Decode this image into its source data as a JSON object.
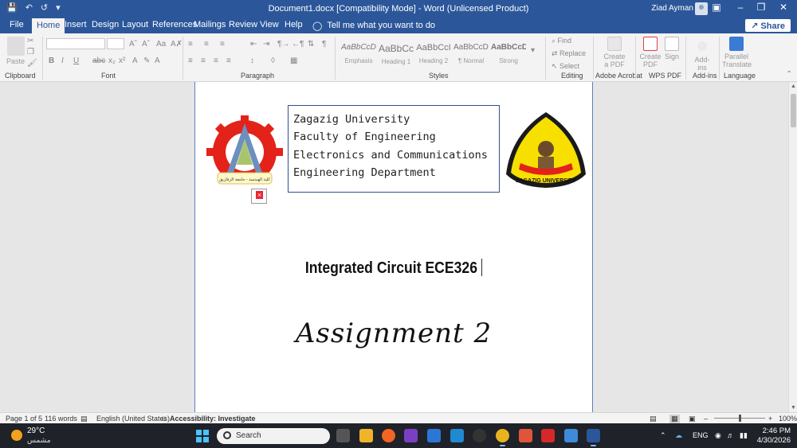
{
  "titlebar": {
    "title": "Document1.docx [Compatibility Mode]  -  Word (Unlicensed Product)",
    "user": "Ziad Ayman",
    "qat": [
      "save-icon",
      "undo-icon",
      "redo-icon",
      "customize-icon"
    ]
  },
  "tabs": [
    "File",
    "Home",
    "Insert",
    "Design",
    "Layout",
    "References",
    "Mailings",
    "Review",
    "View",
    "Help"
  ],
  "active_tab": "Home",
  "tellme": "Tell me what you want to do",
  "share": "Share",
  "ribbon": {
    "clipboard": {
      "label": "Clipboard",
      "paste": "Paste"
    },
    "font": {
      "label": "Font"
    },
    "paragraph": {
      "label": "Paragraph"
    },
    "styles": {
      "label": "Styles",
      "items": [
        {
          "sample": "AaBbCcDd",
          "name": "Emphasis"
        },
        {
          "sample": "AaBbCc",
          "name": "Heading 1"
        },
        {
          "sample": "AaBbCcI",
          "name": "Heading 2"
        },
        {
          "sample": "AaBbCcDdE",
          "name": "¶ Normal"
        },
        {
          "sample": "AaBbCcDc",
          "name": "Strong"
        }
      ]
    },
    "editing": {
      "label": "Editing",
      "find": "Find",
      "replace": "Replace",
      "select": "Select"
    },
    "acrobat": {
      "label": "Adobe Acrobat",
      "create": "Create\na PDF"
    },
    "wps": {
      "label": "WPS PDF",
      "create": "Create\nPDF",
      "sign": "Sign"
    },
    "addins": {
      "label": "Add-ins",
      "btn": "Add-ins"
    },
    "language": {
      "label": "Language",
      "btn": "Parallel\nTranslate"
    }
  },
  "document": {
    "header_lines": [
      "Zagazig University",
      "Faculty of Engineering",
      "Electronics and Communications",
      "Engineering Department"
    ],
    "logo_left_caption": "كلية الهندسة - جامعة الزقازيق",
    "logo_right_caption": "ZAGAZIG UNIVERSITY",
    "course_title": "Integrated Circuit ECE326",
    "assignment": "Assignment 2"
  },
  "statusbar": {
    "page": "Page 1 of 5",
    "words": "116 words",
    "language": "English (United States)",
    "accessibility": "Accessibility: Investigate",
    "zoom": "100%"
  },
  "taskbar": {
    "temp": "29°C",
    "weather": "مشمس",
    "search": "Search",
    "lang": "ENG",
    "time": "2:46 PM",
    "date": "4/30/2026"
  },
  "colors": {
    "word_blue": "#2b579a",
    "page_border": "#5b7fbf",
    "taskbar": "#1f2228"
  }
}
